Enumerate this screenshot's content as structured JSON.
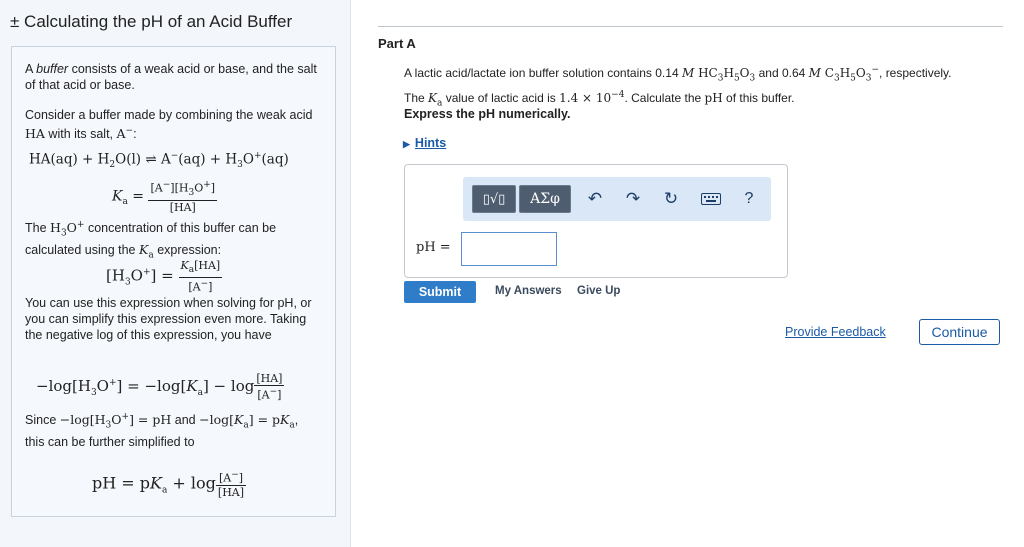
{
  "left": {
    "title": "± Calculating the pH of an Acid Buffer",
    "para1": "A buffer consists of a weak acid or base, and the salt of that acid or base.",
    "para1_italic": "buffer",
    "para2_a": "Consider a buffer made by combining the weak acid",
    "para2_b": "with its salt,",
    "acid_symbol": "HA",
    "salt_symbol": "A",
    "para3_a": "The",
    "para3_b": "concentration of this buffer can be calculated using the",
    "para3_c": "expression:",
    "para4": "You can use this expression when solving for pH, or you can simplify this expression even more. Taking the negative log of this expression, you have",
    "para5_a": "Since",
    "para5_b": "and",
    "para5_c": ", this can be further simplified to"
  },
  "part": {
    "title": "Part A",
    "question_a": "A lactic acid/lactate ion buffer solution contains 0.14",
    "question_b": "and 0.64",
    "question_c": "respectively. The",
    "question_d": "value of lactic acid is",
    "question_e": ". Calculate the",
    "question_f": "of this buffer.",
    "ka_value": "1.4 × 10",
    "ka_exp": "−4",
    "instruction": "Express the pH numerically.",
    "hints": "Hints"
  },
  "answer": {
    "label": "pH =",
    "value": "",
    "toolbar": {
      "templates": "▯√▯",
      "symbols": "ΑΣφ",
      "undo": "undo-icon",
      "redo": "redo-icon",
      "reset": "reset-icon",
      "keyboard": "keyboard-icon",
      "help": "?"
    }
  },
  "actions": {
    "submit": "Submit",
    "my_answers": "My Answers",
    "give_up": "Give Up",
    "feedback": "Provide Feedback",
    "continue": "Continue"
  },
  "colors": {
    "accent": "#2f7cc8",
    "link": "#1a5aa6",
    "toolbar_bg": "#d9e7f6",
    "left_bg": "#f3f6fa"
  }
}
